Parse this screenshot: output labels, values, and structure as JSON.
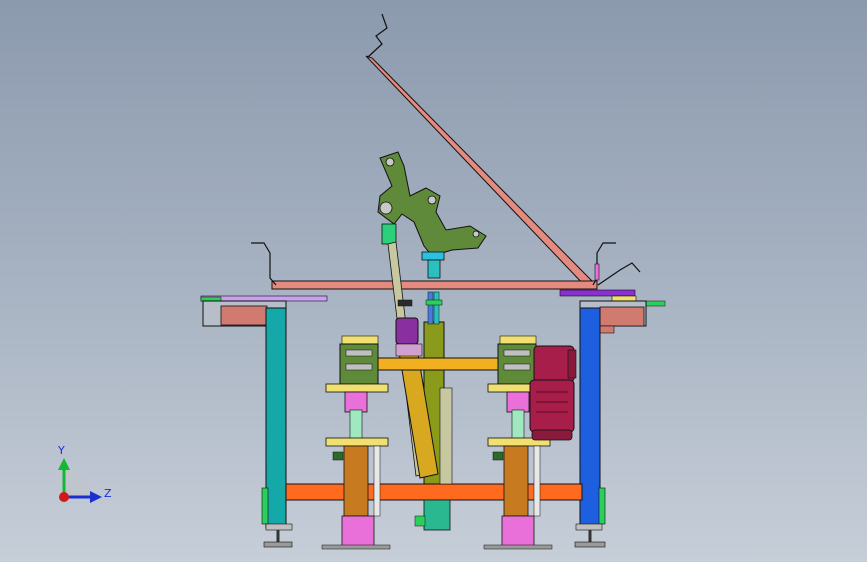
{
  "triad": {
    "y_label": "Y",
    "z_label": "Z"
  },
  "colors": {
    "background_top": "#8c9aae",
    "background_bottom": "#c6ced8",
    "plate": "#e58a7e",
    "leg_left": "#14a8a8",
    "leg_right": "#1e5fe0",
    "crossbar": "#ff6a1e",
    "mechanism_green": "#5f8a3a",
    "cylinder_gold": "#d8a820",
    "motor": "#a81e4a",
    "pink": "#e870d8",
    "yellow_plate": "#f0e070",
    "olive_column": "#8a9a1a"
  }
}
